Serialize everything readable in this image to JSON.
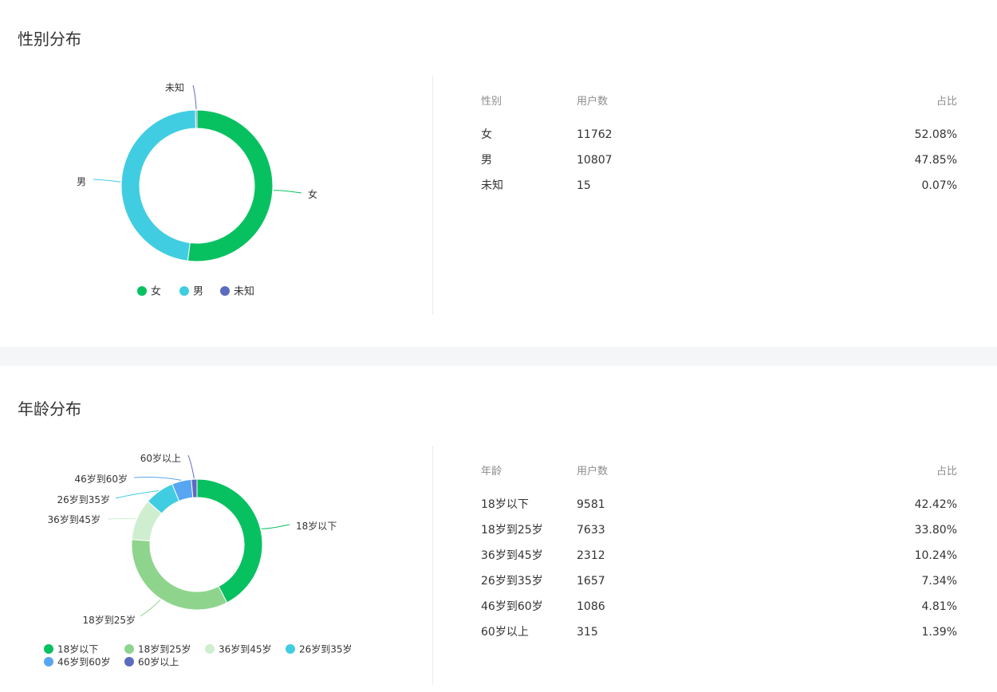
{
  "gender": {
    "title": "性别分布",
    "table": {
      "headers": [
        "性别",
        "用户数",
        "占比"
      ],
      "rows": [
        [
          "女",
          "11762",
          "52.08%"
        ],
        [
          "男",
          "10807",
          "47.85%"
        ],
        [
          "未知",
          "15",
          "0.07%"
        ]
      ]
    }
  },
  "age": {
    "title": "年龄分布",
    "table": {
      "headers": [
        "年龄",
        "用户数",
        "占比"
      ],
      "rows": [
        [
          "18岁以下",
          "9581",
          "42.42%"
        ],
        [
          "18岁到25岁",
          "7633",
          "33.80%"
        ],
        [
          "36岁到45岁",
          "2312",
          "10.24%"
        ],
        [
          "26岁到35岁",
          "1657",
          "7.34%"
        ],
        [
          "46岁到60岁",
          "1086",
          "4.81%"
        ],
        [
          "60岁以上",
          "315",
          "1.39%"
        ]
      ]
    }
  },
  "chart_data": [
    {
      "type": "pie",
      "donut": true,
      "categories": [
        "女",
        "男",
        "未知"
      ],
      "values": [
        11762,
        10807,
        15
      ],
      "colors": [
        "#07c160",
        "#40cde2",
        "#5c6bc0"
      ],
      "legend": "bottom"
    },
    {
      "type": "pie",
      "donut": true,
      "categories": [
        "18岁以下",
        "18岁到25岁",
        "36岁到45岁",
        "26岁到35岁",
        "46岁到60岁",
        "60岁以上"
      ],
      "values": [
        9581,
        7633,
        2312,
        1657,
        1086,
        315
      ],
      "colors": [
        "#07c160",
        "#8ed48d",
        "#cfeecf",
        "#40cde2",
        "#58a6f2",
        "#5c6bc0"
      ],
      "legend": "bottom"
    }
  ]
}
